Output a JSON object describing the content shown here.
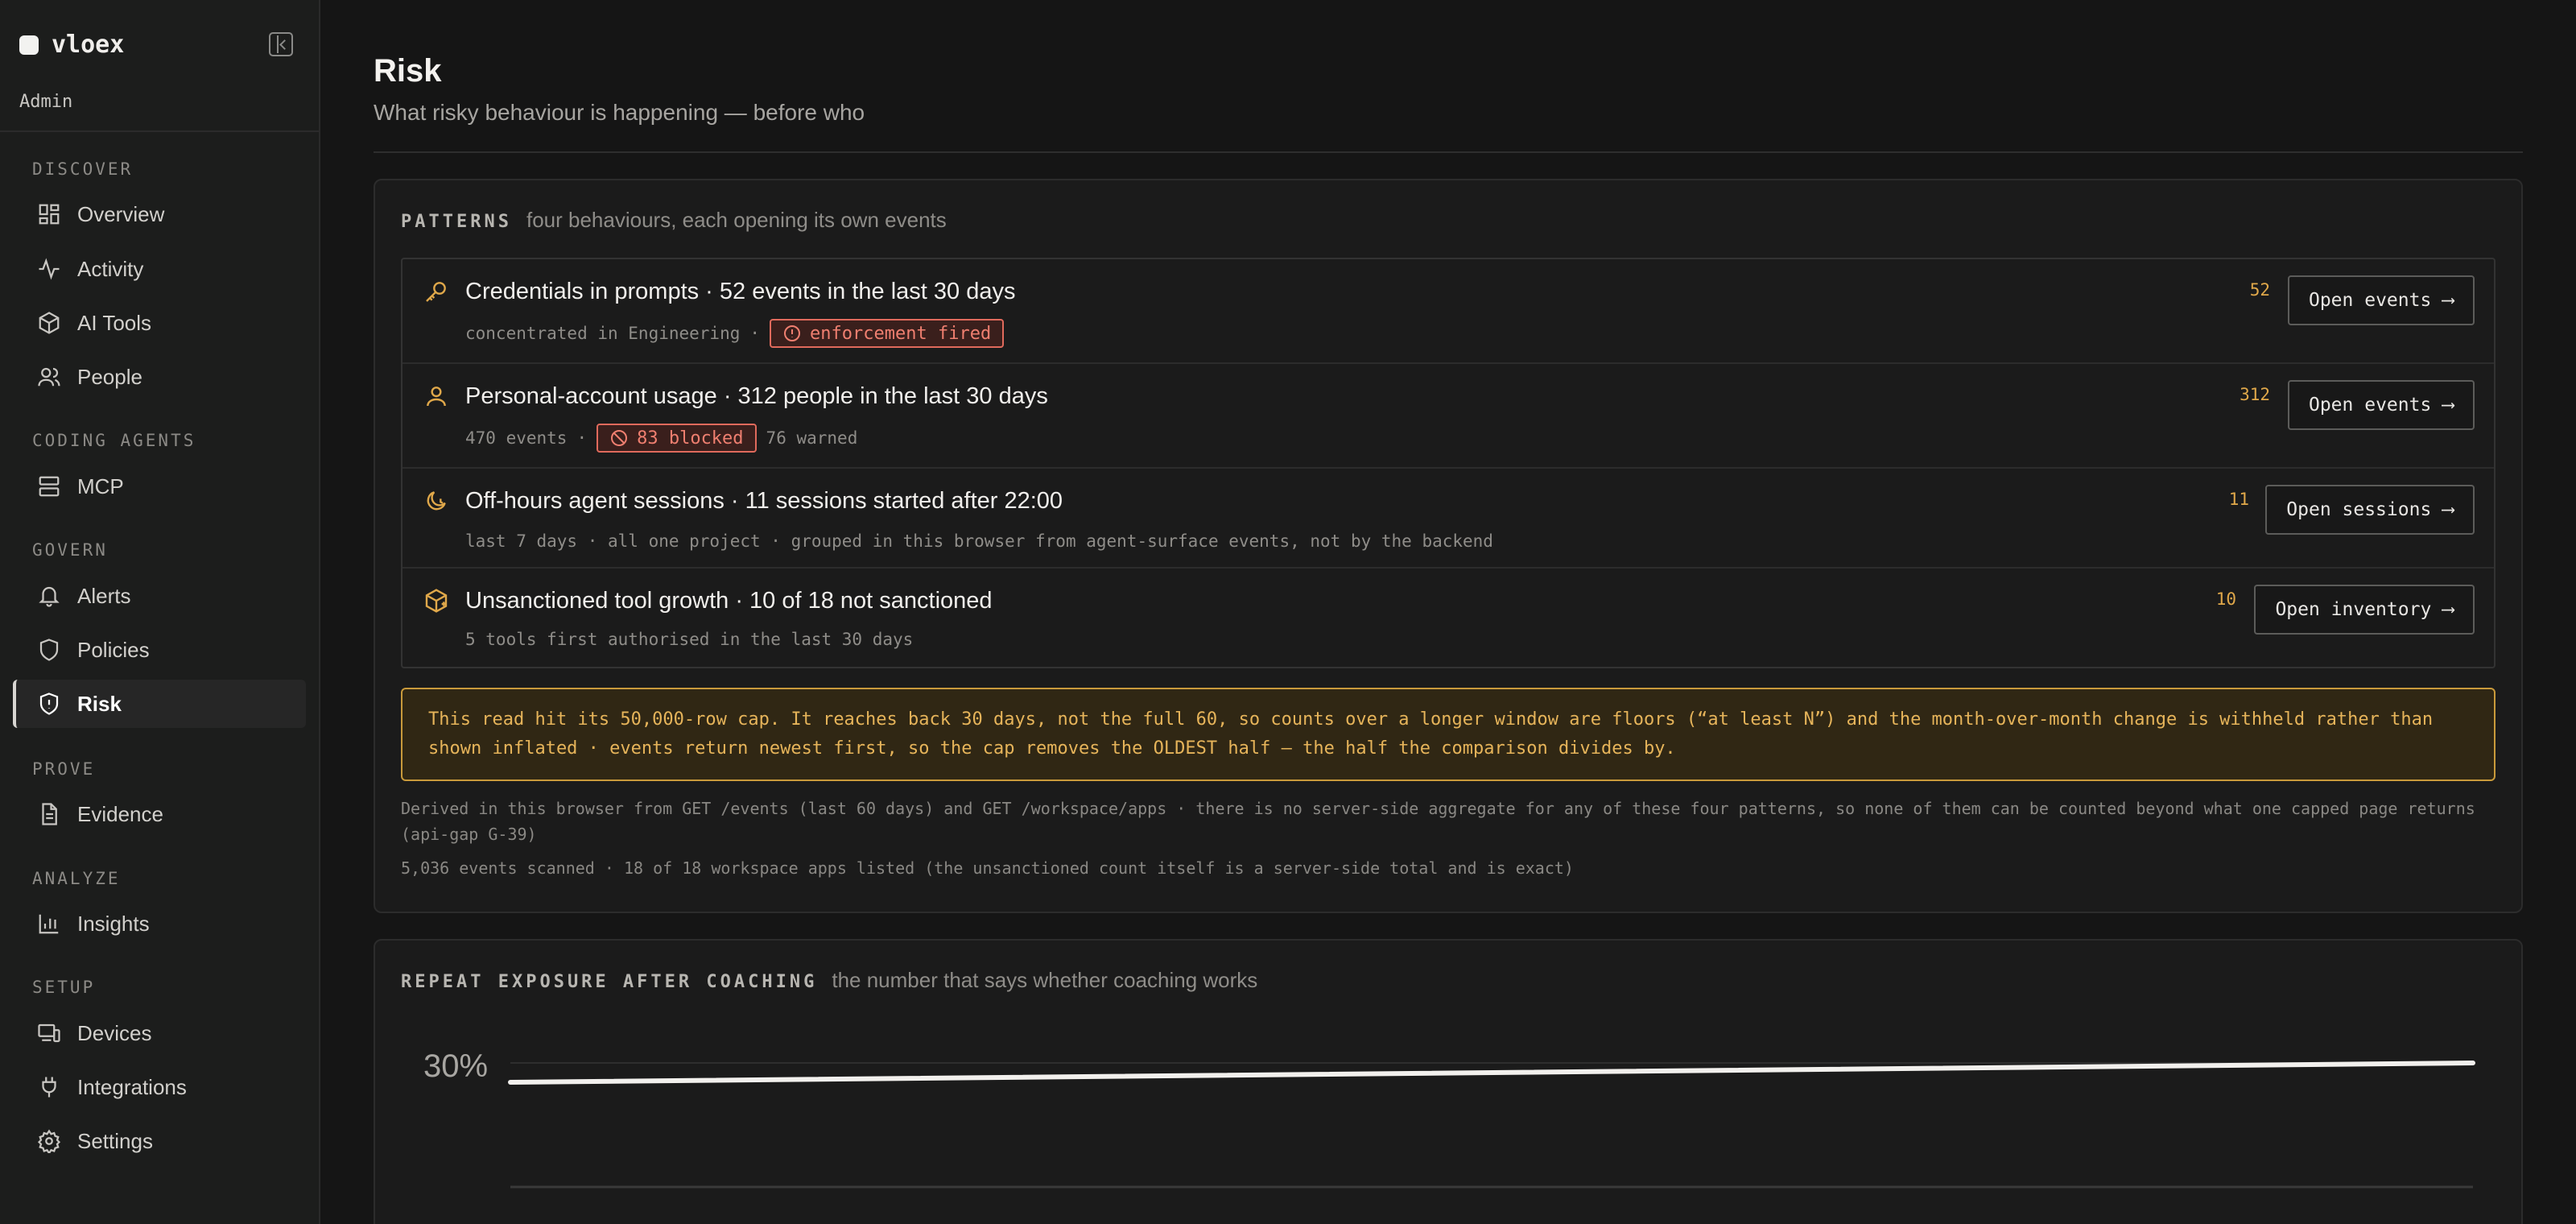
{
  "sidebar": {
    "brand": "vloex",
    "role": "Admin",
    "sections": {
      "discover": "DISCOVER",
      "coding_agents": "CODING AGENTS",
      "govern": "GOVERN",
      "prove": "PROVE",
      "analyze": "ANALYZE",
      "setup": "SETUP"
    },
    "items": {
      "overview": {
        "label": "Overview",
        "icon": "grid-icon"
      },
      "activity": {
        "label": "Activity",
        "icon": "pulse-icon"
      },
      "ai_tools": {
        "label": "AI Tools",
        "icon": "cube-icon"
      },
      "people": {
        "label": "People",
        "icon": "users-icon"
      },
      "mcp": {
        "label": "MCP",
        "icon": "server-icon"
      },
      "alerts": {
        "label": "Alerts",
        "icon": "bell-icon"
      },
      "policies": {
        "label": "Policies",
        "icon": "shield-icon"
      },
      "risk": {
        "label": "Risk",
        "icon": "shield-alert-icon",
        "active": true
      },
      "evidence": {
        "label": "Evidence",
        "icon": "document-icon"
      },
      "insights": {
        "label": "Insights",
        "icon": "bar-chart-icon"
      },
      "devices": {
        "label": "Devices",
        "icon": "devices-icon"
      },
      "integrations": {
        "label": "Integrations",
        "icon": "plug-icon"
      },
      "settings": {
        "label": "Settings",
        "icon": "gear-icon"
      }
    }
  },
  "header": {
    "title": "Risk",
    "subtitle": "What risky behaviour is happening — before who"
  },
  "patterns": {
    "kicker": "PATTERNS",
    "note": "four behaviours, each opening its own events",
    "rows": [
      {
        "title": "Credentials in prompts · 52 events in the last 30 days",
        "meta": "concentrated in Engineering",
        "sep": "·",
        "badge": "enforcement fired",
        "count": "52",
        "button": "Open events ⟶",
        "icon": "key-icon"
      },
      {
        "title": "Personal-account usage · 312 people in the last 30 days",
        "meta": "470 events",
        "sep": "·",
        "badge": "83 blocked",
        "meta_after": "76 warned",
        "count": "312",
        "button": "Open events ⟶",
        "icon": "user-icon"
      },
      {
        "title": "Off-hours agent sessions · 11 sessions started after 22:00",
        "meta": "last 7 days · all one project · grouped in this browser from agent-surface events, not by the backend",
        "count": "11",
        "button": "Open sessions ⟶",
        "icon": "moon-icon"
      },
      {
        "title": "Unsanctioned tool growth · 10 of 18 not sanctioned",
        "meta": "5 tools first authorised in the last 30 days",
        "count": "10",
        "button": "Open inventory ⟶",
        "icon": "package-icon"
      }
    ],
    "warning": "This read hit its 50,000-row cap. It reaches back 30 days, not the full 60, so counts over a longer window are floors (“at least N”) and the month-over-month change is withheld rather than shown inflated · events return newest first, so the cap removes the OLDEST half — the half the comparison divides by.",
    "derived": "Derived in this browser from GET /events (last 60 days) and GET /workspace/apps · there is no server-side aggregate for any of these four patterns, so none of them can be counted beyond what one capped page returns (api-gap G-39)",
    "scanned": "5,036 events scanned · 18 of 18 workspace apps listed (the unsanctioned count itself is a server-side total and is exact)"
  },
  "repeat": {
    "kicker": "REPEAT EXPOSURE AFTER COACHING",
    "note": "the number that says whether coaching works",
    "y_label": "30%"
  },
  "colors": {
    "accent_amber": "#e0a84a",
    "danger_red": "#e06a5c",
    "background": "#151515"
  }
}
